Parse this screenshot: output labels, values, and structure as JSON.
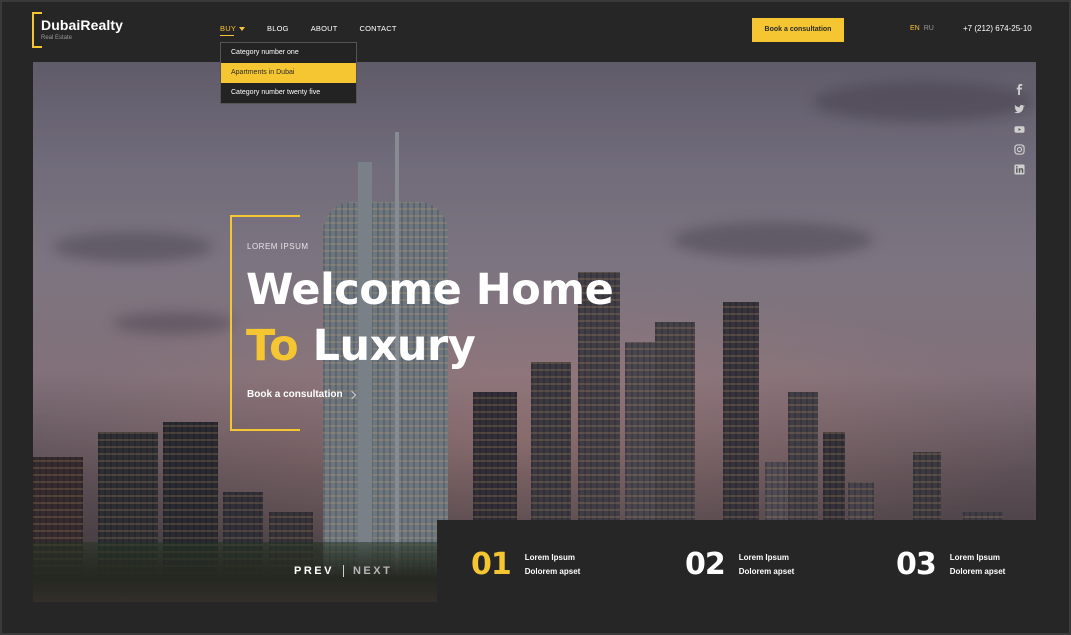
{
  "logo": {
    "name": "DubaiRealty",
    "subtitle": "Real Estate"
  },
  "nav": {
    "items": [
      {
        "label": "BUY",
        "active": true
      },
      {
        "label": "BLOG"
      },
      {
        "label": "ABOUT"
      },
      {
        "label": "CONTACT"
      }
    ],
    "dropdown": [
      {
        "label": "Category number one"
      },
      {
        "label": "Apartments in Dubai",
        "highlighted": true
      },
      {
        "label": "Category number twenty five"
      }
    ]
  },
  "header": {
    "cta_label": "Book a consultation",
    "languages": {
      "active": "EN",
      "other": "RU"
    },
    "phone": "+7 (212) 674-25-10"
  },
  "social": [
    "facebook-icon",
    "twitter-icon",
    "youtube-icon",
    "instagram-icon",
    "linkedin-icon"
  ],
  "hero": {
    "eyebrow": "LOREM IPSUM",
    "headline_line1": "Welcome Home",
    "headline_accent": "To",
    "headline_rest": " Luxury",
    "cta_label": "Book a consultation",
    "prev_label": "PREV",
    "next_label": "NEXT"
  },
  "stats": [
    {
      "number": "01",
      "line1": "Lorem Ipsum",
      "line2": "Dolorem apset",
      "accent": true
    },
    {
      "number": "02",
      "line1": "Lorem Ipsum",
      "line2": "Dolorem apset",
      "accent": false
    },
    {
      "number": "03",
      "line1": "Lorem Ipsum",
      "line2": "Dolorem apset",
      "accent": false
    }
  ],
  "colors": {
    "accent": "#f5c631",
    "background": "#262626"
  }
}
